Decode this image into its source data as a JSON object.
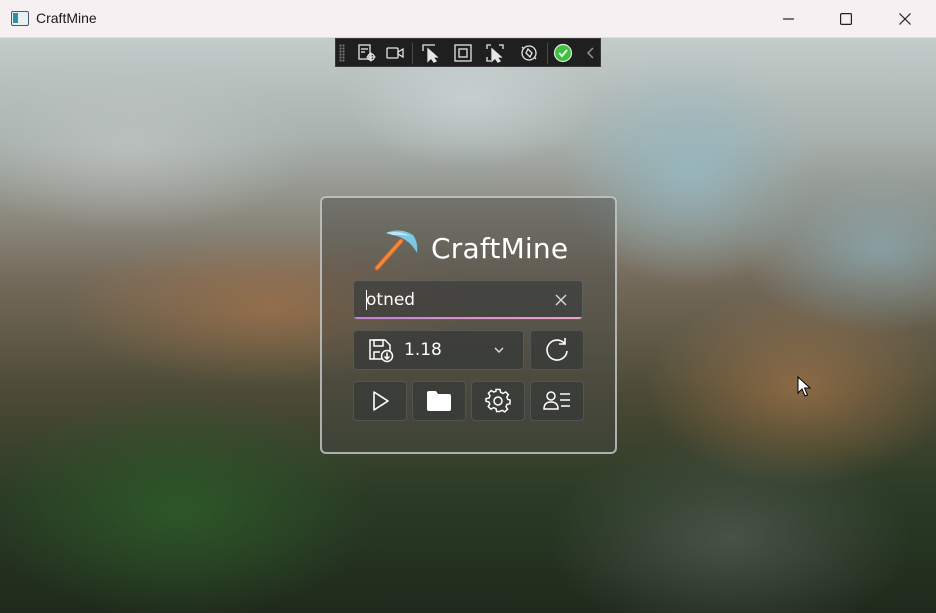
{
  "window": {
    "title": "CraftMine",
    "controls": [
      "minimize",
      "maximize",
      "close"
    ]
  },
  "debug_toolbar": {
    "icons": [
      "live-visual-tree-icon",
      "record-icon",
      "select-element-icon",
      "display-layout-adorners-icon",
      "track-focused-element-icon",
      "hot-reload-icon",
      "binding-ok-icon",
      "collapse-toolbar-icon"
    ],
    "status_color": "#3cc23c"
  },
  "launcher": {
    "brand": "CraftMine",
    "logo": "pickaxe-logo",
    "search": {
      "value": "otned",
      "clear_icon": "close-icon"
    },
    "version": {
      "selected": "1.18",
      "icon": "save-download-icon",
      "dropdown_icon": "chevron-down-icon"
    },
    "refresh_icon": "refresh-icon",
    "actions": [
      "play-icon",
      "folder-icon",
      "settings-icon",
      "accounts-icon"
    ],
    "accent_colors": [
      "#c080d8",
      "#f0a0c8"
    ]
  }
}
